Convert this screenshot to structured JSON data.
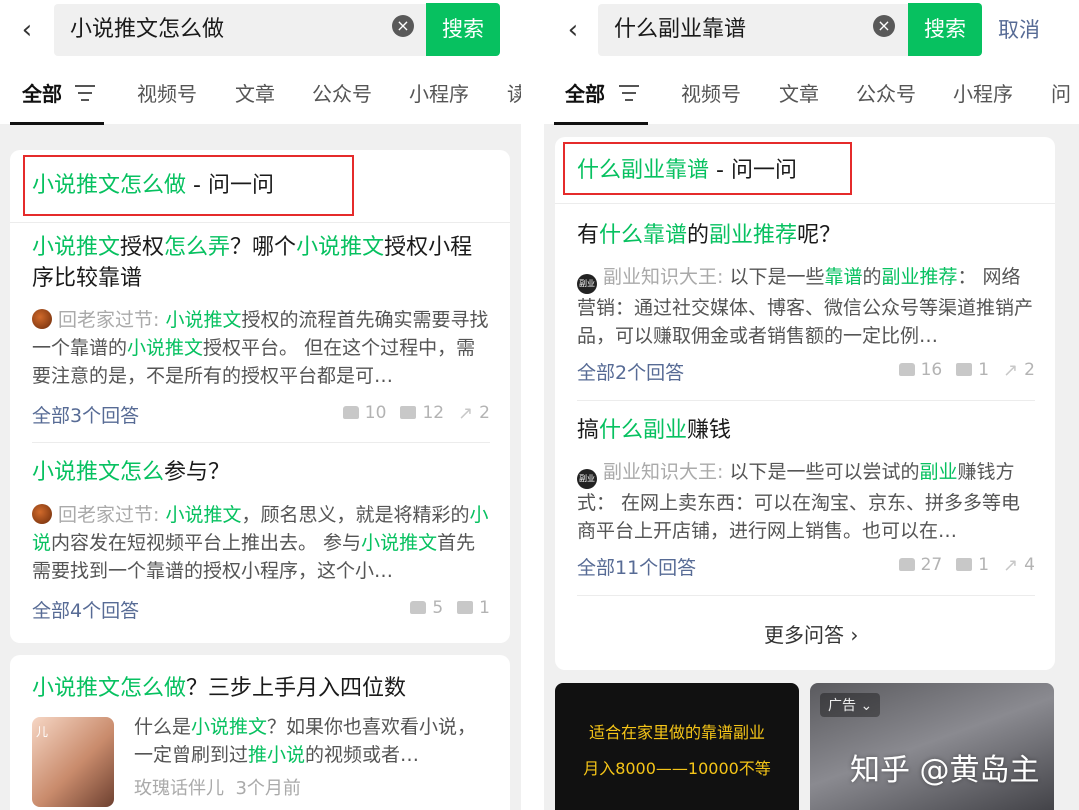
{
  "left": {
    "search_query": "小说推文怎么做",
    "search_button": "搜索",
    "tabs": [
      "全部",
      "视频号",
      "文章",
      "公众号",
      "小程序",
      "读"
    ],
    "ask_card": {
      "title_green": "小说推文怎么做",
      "title_suffix": " - 问一问",
      "questions": [
        {
          "title_parts": [
            "小说推文",
            "授权",
            "怎么弄",
            "？哪个",
            "小说推文",
            "授权小程序比较靠谱"
          ],
          "author": "回老家过节:",
          "answer_parts": [
            "小说推文",
            "授权的流程首先确实需要寻找一个靠谱的",
            "小说推文",
            "授权平台。 但在这个过程中，需要注意的是，不是所有的授权平台都是可…"
          ],
          "all_answers": "全部3个回答",
          "likes": "10",
          "comments": "12",
          "shares": "2"
        },
        {
          "title_parts": [
            "小说推文",
            "怎么",
            "参与？"
          ],
          "author": "回老家过节:",
          "answer_parts": [
            "小说推文",
            "，顾名思义，就是将精彩的",
            "小说",
            "内容发在短视频平台上推出去。 参与",
            "小说推文",
            "首先需要找到一个靠谱的授权小程序，这个小…"
          ],
          "all_answers": "全部4个回答",
          "likes": "5",
          "comments": "1"
        }
      ]
    },
    "article_card": {
      "title_parts": [
        "小说推文怎么做",
        "？三步上手月入四位数"
      ],
      "desc_parts": [
        "什么是",
        "小说推文",
        "？如果你也喜欢看小说，一定曾刷到过",
        "推小说",
        "的视频或者…"
      ],
      "source": "玫瑰话伴儿",
      "time": "3个月前",
      "thumb_caption": "儿"
    }
  },
  "right": {
    "search_query": "什么副业靠谱",
    "search_button": "搜索",
    "cancel": "取消",
    "tabs": [
      "全部",
      "视频号",
      "文章",
      "公众号",
      "小程序",
      "问"
    ],
    "ask_card": {
      "title_green": "什么副业靠谱",
      "title_suffix": " - 问一问",
      "questions": [
        {
          "title_parts": [
            "有",
            "什么靠谱",
            "的",
            "副业推荐",
            "呢？"
          ],
          "author_badge": "副业",
          "author": "副业知识大王:",
          "answer_parts": [
            " 以下是一些",
            "靠谱",
            "的",
            "副业推荐",
            "： 网络营销：通过社交媒体、博客、微信公众号等渠道推销产品，可以赚取佣金或者销售额的一定比例…"
          ],
          "all_answers": "全部2个回答",
          "likes": "16",
          "comments": "1",
          "shares": "2"
        },
        {
          "title_parts": [
            "搞",
            "什么副业",
            "赚钱"
          ],
          "author_badge": "副业",
          "author": "副业知识大王:",
          "answer_parts": [
            " 以下是一些可以尝试的",
            "副业",
            "赚钱方式： 在网上卖东西：可以在淘宝、京东、拼多多等电商平台上开店铺，进行网上销售。也可以在…"
          ],
          "all_answers": "全部11个回答",
          "likes": "27",
          "comments": "1",
          "shares": "4"
        }
      ],
      "more": "更多问答"
    },
    "video_left": {
      "line1": "适合在家里做的靠谱副业",
      "line2": "月入8000——10000不等"
    },
    "video_right": {
      "ad_badge": "广告"
    }
  },
  "watermark": "知乎 @黄岛主",
  "colors": {
    "accent_green": "#07c160",
    "link_blue": "#576b95",
    "highlight_red": "#e52b2b"
  }
}
